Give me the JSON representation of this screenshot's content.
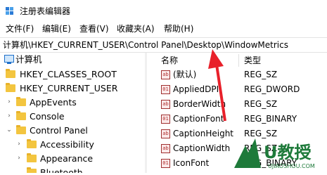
{
  "window": {
    "title": "注册表编辑器"
  },
  "menu": [
    "文件(F)",
    "编辑(E)",
    "查看(V)",
    "收藏夹(A)",
    "帮助(H)"
  ],
  "address": {
    "path": "计算机\\HKEY_CURRENT_USER\\Control Panel\\Desktop\\WindowMetrics"
  },
  "tree": {
    "root": "计算机",
    "items": [
      {
        "label": "HKEY_CLASSES_ROOT"
      },
      {
        "label": "HKEY_CURRENT_USER"
      },
      {
        "label": "AppEvents"
      },
      {
        "label": "Console"
      },
      {
        "label": "Control Panel"
      },
      {
        "label": "Accessibility"
      },
      {
        "label": "Appearance"
      },
      {
        "label": "Bluetooth"
      }
    ]
  },
  "values": {
    "headers": {
      "name": "名称",
      "type": "类型"
    },
    "rows": [
      {
        "name": "(默认)",
        "type": "REG_SZ",
        "icon": "ab"
      },
      {
        "name": "AppliedDPI",
        "type": "REG_DWORD",
        "icon": "01"
      },
      {
        "name": "BorderWidth",
        "type": "REG_SZ",
        "icon": "ab"
      },
      {
        "name": "CaptionFont",
        "type": "REG_BINARY",
        "icon": "01"
      },
      {
        "name": "CaptionHeight",
        "type": "REG_SZ",
        "icon": "ab"
      },
      {
        "name": "CaptionWidth",
        "type": "REG_SZ",
        "icon": "ab"
      },
      {
        "name": "IconFont",
        "type": "REG_BINARY",
        "icon": "01"
      }
    ]
  },
  "watermark": {
    "text": "U教授",
    "subtext": "UJIAOSHOU.COM"
  },
  "colors": {
    "accent_arrow": "#e8202a",
    "folder": "#f3c53f",
    "watermark": "#1e7a3a"
  }
}
